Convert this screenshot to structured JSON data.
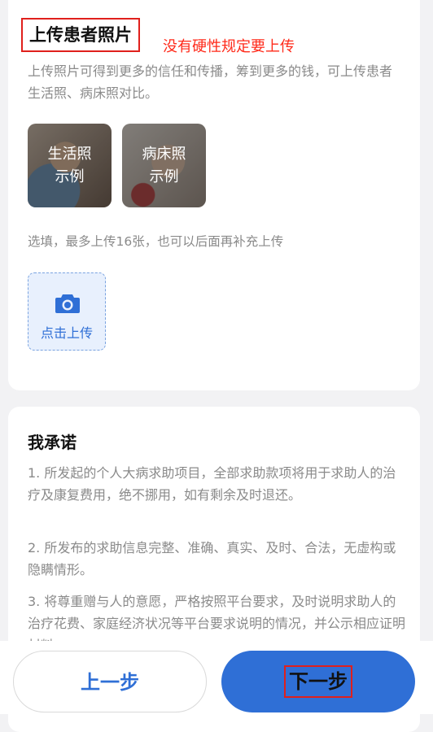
{
  "photos": {
    "title": "上传患者照片",
    "annotation": "没有硬性规定要上传",
    "description": "上传照片可得到更多的信任和传播，筹到更多的钱，可上传患者生活照、病床照对比。",
    "examples": [
      {
        "label_line1": "生活照",
        "label_line2": "示例"
      },
      {
        "label_line1": "病床照",
        "label_line2": "示例"
      }
    ],
    "hint": "选填，最多上传16张，也可以后面再补充上传",
    "upload_label": "点击上传"
  },
  "promise": {
    "title": "我承诺",
    "items": [
      "1. 所发起的个人大病求助项目，全部求助款项将用于求助人的治疗及康复费用，绝不挪用，如有剩余及时退还。",
      "2. 所发布的求助信息完整、准确、真实、及时、合法，无虚构或隐瞒情形。",
      "3. 将尊重赠与人的意愿，严格按照平台要求，及时说明求助人的治疗花费、家庭经济状况等平台要求说明的情况，并公示相应证明材料。"
    ]
  },
  "footer": {
    "prev_label": "上一步",
    "next_label": "下一步"
  },
  "colors": {
    "accent": "#2f6fd6",
    "annotation_red": "#ff2a1a",
    "muted_text": "#8a8a8a"
  },
  "icons": {
    "upload": "camera-icon"
  }
}
